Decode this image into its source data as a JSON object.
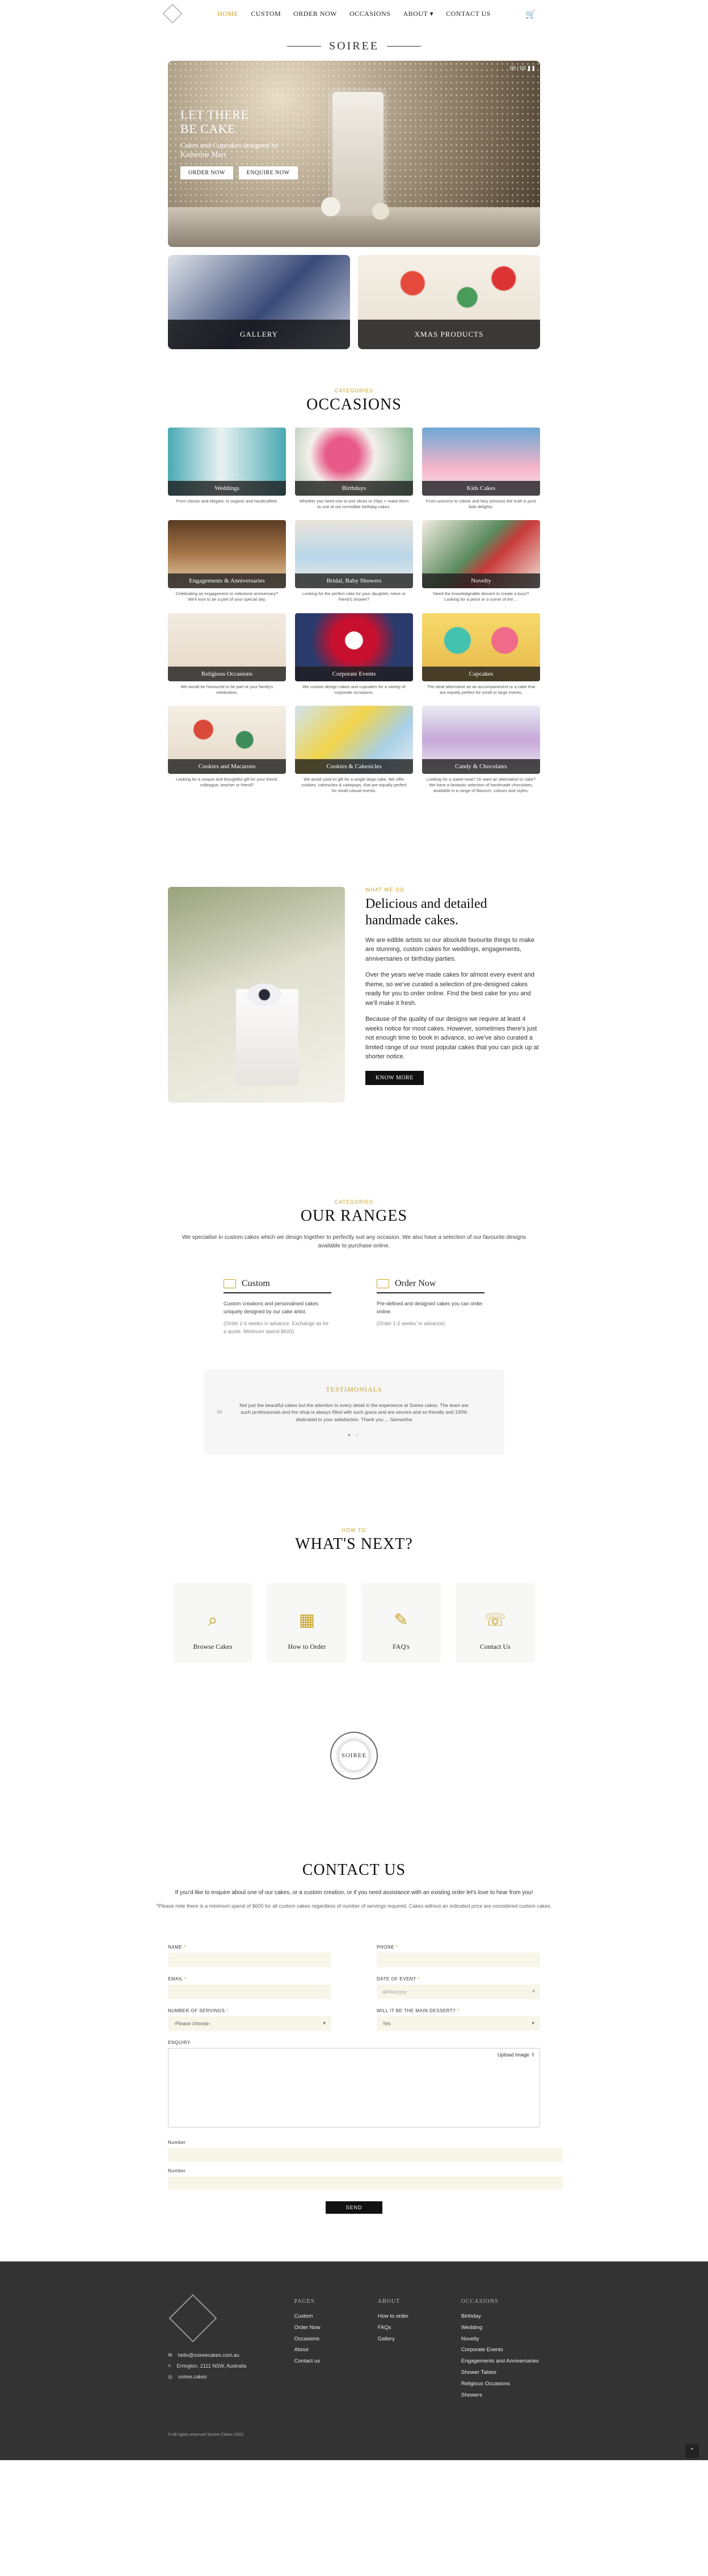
{
  "nav": {
    "items": [
      {
        "label": "HOME",
        "active": true
      },
      {
        "label": "CUSTOM",
        "active": false
      },
      {
        "label": "ORDER NOW",
        "active": false
      },
      {
        "label": "OCCASIONS",
        "active": false
      },
      {
        "label": "ABOUT ▾",
        "active": false
      },
      {
        "label": "CONTACT US",
        "active": false
      }
    ],
    "cart_icon": "cart-icon"
  },
  "brand": "SOIREE",
  "hero": {
    "title_line1": "LET THERE",
    "title_line2": "BE CAKE",
    "subtitle_line1": "Cakes and Cupcakes designed by",
    "subtitle_line2": "Katherine Marr",
    "btn_order": "ORDER NOW",
    "btn_enquire": "ENQUIRE NOW",
    "slide_control": "00 / 03 ❚❚"
  },
  "twin": {
    "gallery": "GALLERY",
    "xmas": "XMAS PRODUCTS"
  },
  "occasions": {
    "eyebrow": "CATEGORIES",
    "title": "OCCASIONS",
    "items": [
      {
        "label": "Weddings",
        "desc": "From classic and elegant, to organic and handcrafted."
      },
      {
        "label": "Birthdays",
        "desc": "Whether you need one to one slices or 20pc + make them to one of our incredible birthday cakes."
      },
      {
        "label": "Kids Cakes",
        "desc": "From unicorns to robots and fairy princess the truth is pure kids delights."
      },
      {
        "label": "Engagements & Anniversaries",
        "desc": "Celebrating an engagement or milestone anniversary? We'll love to be a part of your special day."
      },
      {
        "label": "Bridal, Baby Showers",
        "desc": "Looking for the perfect cake for your daughter, niece or friend's shower?"
      },
      {
        "label": "Novelty",
        "desc": "Need the knowledgeable dessert to create a buzz? Looking for a piece or a scene of the ..."
      },
      {
        "label": "Religious Occasions",
        "desc": "We would be honoured to be part of your family's celebration."
      },
      {
        "label": "Corporate Events",
        "desc": "We custom design cakes and cupcakes for a variety of corporate occasions."
      },
      {
        "label": "Cupcakes",
        "desc": "The ideal alternative as an accompaniment or a cake that are equally perfect for small or large events."
      },
      {
        "label": "Cookies and Macarons",
        "desc": "Looking for a unique and thoughtful gift for your friend, colleague, teacher or friend?"
      },
      {
        "label": "Cookies & Cakesicles",
        "desc": "We avoid used to gift for a single large cake. We offer cookies, cakesicles & cakepops, that are equally perfect for small casual events."
      },
      {
        "label": "Candy & Chocolates",
        "desc": "Looking for a sweet treat? Or want an alternative to cake? We have a fantastic selection of handmade chocolates, available in a range of flavours, colours and styles."
      }
    ]
  },
  "wwd": {
    "eyebrow": "WHAT WE DO",
    "title_line1": "Delicious and detailed",
    "title_line2": "handmade cakes.",
    "p1": "We are edible artists so our absolute favourite things to make are stunning, custom cakes for weddings, engagements, anniversaries or birthday parties.",
    "p2": "Over the years we've made cakes for almost every event and theme, so we've curated a selection of pre-designed cakes ready for you to order online. Find the best cake for you and we'll make it fresh.",
    "p3": "Because of the quality of our designs we require at least 4 weeks notice for most cakes. However, sometimes there's just not enough time to book in advance, so we've also curated a limited range of our most popular cakes that you can pick up at shorter notice.",
    "button": "KNOW MORE"
  },
  "ranges": {
    "eyebrow": "CATEGORIES",
    "title": "OUR RANGES",
    "desc": "We specialise in custom cakes which we design together to perfectly suit any occasion. We also have a selection of our favourite designs available to purchase online.",
    "custom": {
      "title": "Custom",
      "p1": "Custom creations and personalised cakes uniquely designed by our cake artist.",
      "p2": "(Order 2-6 weeks in advance. Exchange as for a quote. Minimum spend $600)"
    },
    "order": {
      "title": "Order Now",
      "p1": "Pre-defined and designed cakes you can order online.",
      "p2": "(Order 1-2 weeks' in advance)"
    }
  },
  "testimonial": {
    "title": "TESTIMONIALS",
    "quote": "Not just the beautiful cakes but the attention to every detail in the experience at Soiree cakes. The team are such professionals and the shop is always filled with such grace and are sincere and so friendly and 100% dedicated to your satisfaction. Thank you ... Samantha",
    "dots": "● ○"
  },
  "next": {
    "eyebrow": "HOW TO",
    "title": "WHAT'S NEXT?",
    "items": [
      {
        "label": "Browse Cakes",
        "icon": "search-icon"
      },
      {
        "label": "How to Order",
        "icon": "shop-icon"
      },
      {
        "label": "FAQ's",
        "icon": "faq-icon"
      },
      {
        "label": "Contact Us",
        "icon": "contact-icon"
      }
    ]
  },
  "seal": "SOIREE",
  "contact": {
    "title": "CONTACT US",
    "intro": "If you'd like to enquire about one of our cakes, or a custom creation, or if you need assistance with an existing order let's love to hear from you!",
    "note": "*Please note there is a minimum spend of $600 for all custom cakes regardless of number of servings required. Cakes without an indicated price are considered custom cakes.",
    "name_label": "NAME",
    "phone_label": "PHONE",
    "email_label": "EMAIL",
    "date_label": "DATE OF EVENT",
    "date_placeholder": "dd/mm/yyyy",
    "servings_label": "NUMBER OF SERVINGS",
    "servings_value": "-Please choose-",
    "main_dessert_label": "WILL IT BE THE MAIN DESSERT?",
    "main_dessert_value": "Yes",
    "enquiry_label": "ENQUIRY",
    "upload_label": "Upload Image",
    "number1_label": "Number",
    "number2_label": "Number",
    "send": "SEND"
  },
  "footer": {
    "email": "hello@soireecakes.com.au",
    "address": "Errington, 2111 NSW, Australia",
    "instagram": "soiree.cakes",
    "pages_title": "PAGES",
    "pages": [
      "Custom",
      "Order Now",
      "Occasions",
      "About",
      "Contact us"
    ],
    "about_title": "ABOUT",
    "about": [
      "How to order",
      "FAQs",
      "Gallery"
    ],
    "occ_title": "OCCASIONS",
    "occasions": [
      "Birthday",
      "Wedding",
      "Novelty",
      "Corporate Events",
      "Engagements and Anniversaries",
      "Shower Tables",
      "Religious Occasions",
      "Showers"
    ],
    "copyright": "© All rights reserved Soiree Cakes 2022"
  }
}
